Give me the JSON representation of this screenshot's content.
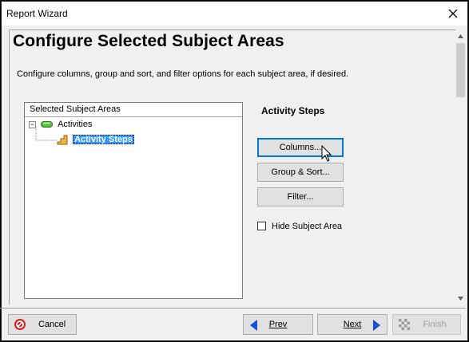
{
  "window": {
    "title": "Report Wizard",
    "close_icon": "close-icon"
  },
  "header": {
    "title": "Configure Selected Subject Areas",
    "description": "Configure columns, group and sort, and filter options for each subject area, if desired."
  },
  "tree": {
    "header": "Selected Subject Areas",
    "items": [
      {
        "label": "Activities",
        "icon": "green-pill-icon",
        "expanded": true
      },
      {
        "label": "Activity Steps",
        "icon": "steps-icon",
        "selected": true
      }
    ]
  },
  "options": {
    "title": "Activity Steps",
    "columns_label": "Columns...",
    "group_sort_label": "Group & Sort...",
    "filter_label": "Filter...",
    "hide_subject_area_label": "Hide Subject Area",
    "hide_subject_area_checked": false
  },
  "footer": {
    "cancel_label": "Cancel",
    "prev_label": "Prev",
    "next_label": "Next",
    "finish_label": "Finish",
    "finish_enabled": false
  },
  "colors": {
    "selection": "#3399ff",
    "nav_arrow": "#1b4fd1",
    "cancel_red": "#d71e1e"
  }
}
